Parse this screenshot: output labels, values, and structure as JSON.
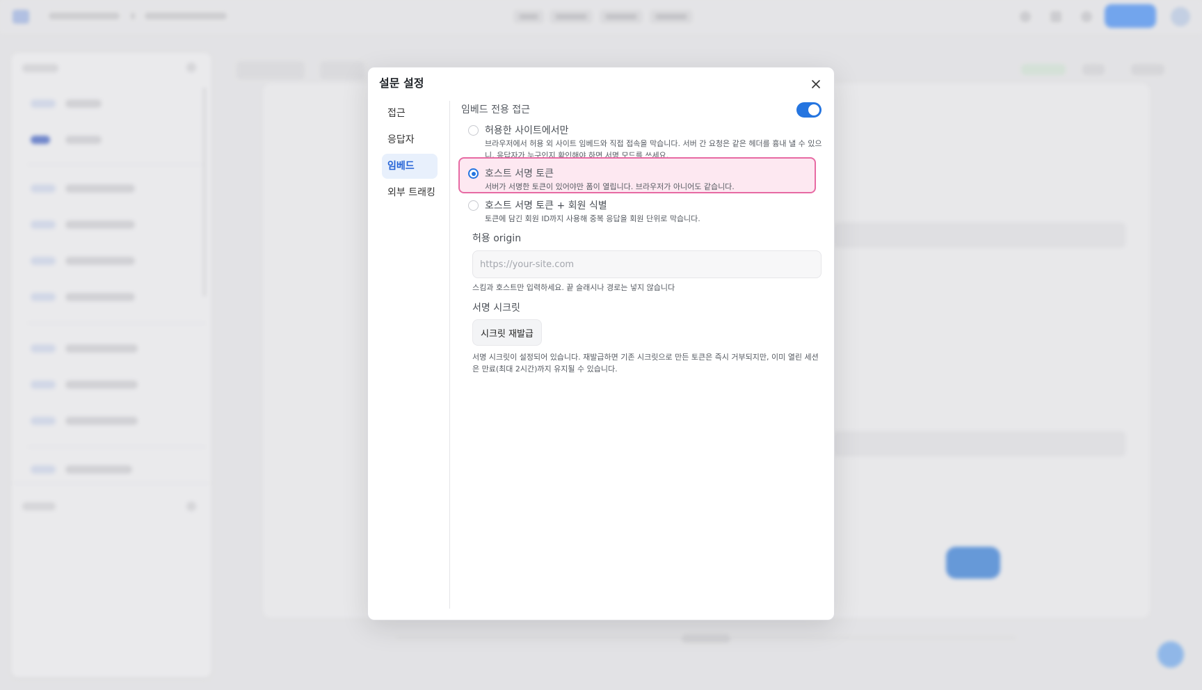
{
  "modal": {
    "title": "설문 설정",
    "menu": [
      {
        "label": "접근",
        "active": false
      },
      {
        "label": "응답자",
        "active": false
      },
      {
        "label": "임베드",
        "active": true
      },
      {
        "label": "외부 트래킹",
        "active": false
      }
    ],
    "embed": {
      "section_label": "임베드 전용 접근",
      "toggle_on": true,
      "options": [
        {
          "title": "허용한 사이트에서만",
          "description": "브라우저에서 허용 외 사이트 임베드와 직접 접속을 막습니다. 서버 간 요청은 같은 헤더를 흉내 낼 수 있으니, 응답자가 누구인지 확인해야 하면 서명 모드를 쓰세요.",
          "selected": false
        },
        {
          "title": "호스트 서명 토큰",
          "description": "서버가 서명한 토큰이 있어야만 폼이 열립니다. 브라우저가 아니어도 같습니다.",
          "selected": true
        },
        {
          "title": "호스트 서명 토큰 + 회원 식별",
          "description": "토큰에 담긴 회원 ID까지 사용해 중복 응답을 회원 단위로 막습니다.",
          "selected": false
        }
      ],
      "origin": {
        "label": "허용 origin",
        "value": "",
        "placeholder": "https://your-site.com",
        "hint": "스킴과 호스트만 입력하세요. 끝 슬래시나 경로는 넣지 않습니다"
      },
      "secret": {
        "label": "서명 시크릿",
        "button_label": "시크릿 재발급",
        "hint": "서명 시크릿이 설정되어 있습니다. 재발급하면 기존 시크릿으로 만든 토큰은 즉시 거부되지만, 이미 열린 세션은 만료(최대 2시간)까지 유지될 수 있습니다."
      }
    }
  },
  "colors": {
    "accent": "#2575e0",
    "highlight_border": "#e76aa3",
    "highlight_fill": "#fde8f1"
  },
  "icons": {
    "close": "close-icon"
  }
}
